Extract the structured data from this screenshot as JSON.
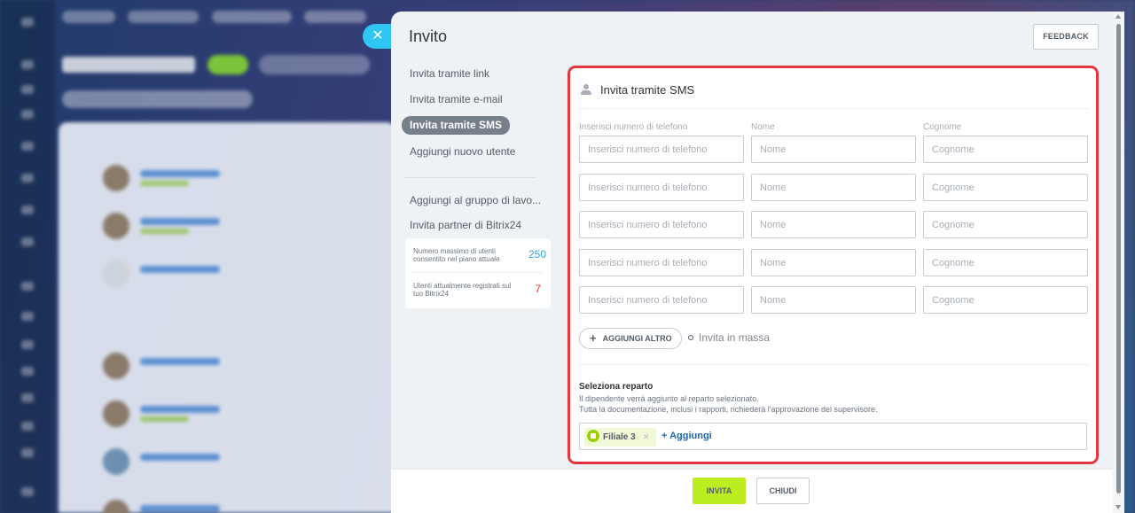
{
  "slider": {
    "title": "Invito",
    "feedback_label": "FEEDBACK",
    "close_icon": "close-icon"
  },
  "menu": {
    "items": [
      {
        "label": "Invita tramite link"
      },
      {
        "label": "Invita tramite e-mail"
      },
      {
        "label": "Invita tramite SMS",
        "active": true
      },
      {
        "label": "Aggiungi nuovo utente"
      },
      {
        "label": "Aggiungi al gruppo di lavo..."
      },
      {
        "label": "Invita partner di Bitrix24"
      }
    ],
    "limits": [
      {
        "label": "Numero massimo di utenti consentito nel piano attuale",
        "value": "250",
        "color": "#2fa3d6"
      },
      {
        "label": "Utenti attualmente registrati sul tuo Bitrix24",
        "value": "7",
        "color": "#e5363e"
      }
    ]
  },
  "form": {
    "title": "Invita tramite SMS",
    "columns": [
      "Inserisci numero di telefono",
      "Nome",
      "Cognome"
    ],
    "placeholders": {
      "phone": "Inserisci numero di telefono",
      "name": "Nome",
      "surname": "Cognome"
    },
    "add_more_label": "AGGIUNGI ALTRO",
    "mass_invite_label": "Invita in massa",
    "department": {
      "title": "Seleziona reparto",
      "desc_line1": "Il dipendente verrà aggiunto al reparto selezionato.",
      "desc_line2": "Tutta la documentazione, inclusi i rapporti, richiederà l'approvazione del supervisore.",
      "selected_tag": "Filiale 3",
      "add_label": "+ Aggiungi"
    }
  },
  "footer": {
    "invite_label": "INVITA",
    "close_label": "CHIUDI"
  },
  "colors": {
    "accent_green": "#bbed21",
    "highlight_border": "#e5363e",
    "link_blue": "#2067b0"
  }
}
